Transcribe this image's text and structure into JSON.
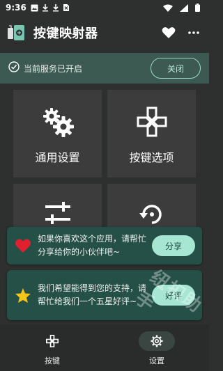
{
  "status_bar": {
    "time": "9:36",
    "icons": [
      "gallery-icon",
      "download-icon",
      "download-icon",
      "no-sim-icon",
      "wifi-icon",
      "signal-icon",
      "battery-icon"
    ]
  },
  "app_bar": {
    "title": "按键映射器",
    "actions": [
      "favorite-icon",
      "more-icon"
    ]
  },
  "service": {
    "status_text": "当前服务已开启",
    "close_label": "关闭"
  },
  "tiles": [
    {
      "label": "通用设置",
      "icon": "gears-icon"
    },
    {
      "label": "按键选项",
      "icon": "gamepad-icon"
    },
    {
      "label": "",
      "icon": "sliders-icon"
    },
    {
      "label": "",
      "icon": "restore-icon"
    }
  ],
  "cards": [
    {
      "text": "如果你喜欢这个应用，请帮忙分享给你的小伙伴吧~",
      "button": "分享",
      "icon": "heart-icon"
    },
    {
      "text": "我们希望能得到您的支持，请帮忙给我们一个五星好评~",
      "button": "好评",
      "icon": "star-icon"
    }
  ],
  "watermark": "纽扣助手",
  "bottom_nav": [
    {
      "label": "按键",
      "icon": "gamepad-icon",
      "active": false
    },
    {
      "label": "设置",
      "icon": "gear-icon",
      "active": true
    }
  ],
  "colors": {
    "background": "#2e302f",
    "service_bar": "#3c5a52",
    "tile": "#3b3c3b",
    "card": "#245047",
    "accent": "#a6e6d3"
  }
}
